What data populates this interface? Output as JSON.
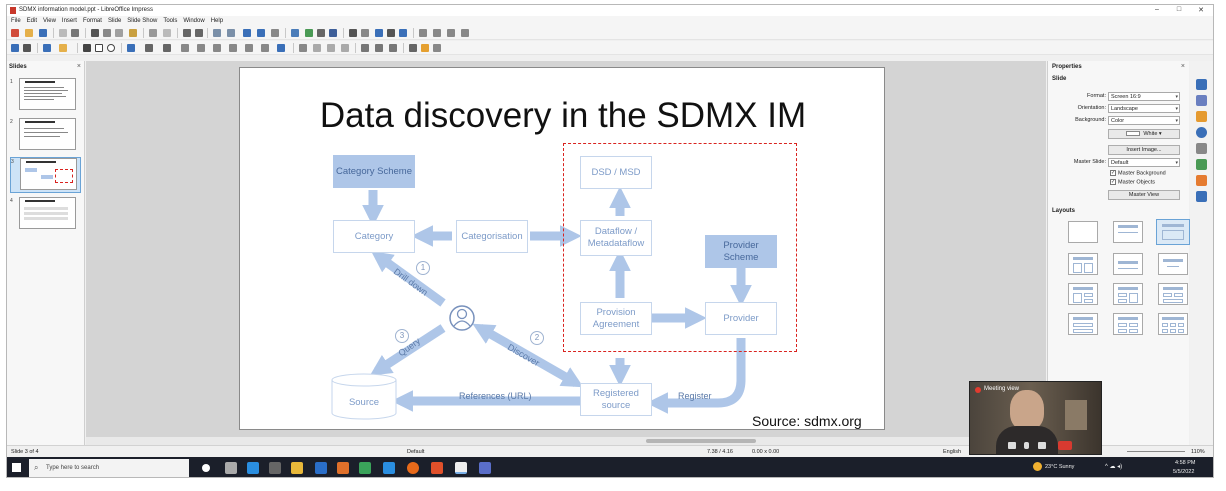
{
  "window": {
    "title": "SDMX information model.ppt - LibreOffice Impress",
    "controls": [
      "–",
      "□",
      "✕"
    ]
  },
  "menu": [
    "File",
    "Edit",
    "View",
    "Insert",
    "Format",
    "Slide",
    "Slide Show",
    "Tools",
    "Window",
    "Help"
  ],
  "slides_pane": {
    "title": "Slides",
    "close": "×",
    "numbers": [
      "1",
      "2",
      "3",
      "4"
    ],
    "selected_index": 3
  },
  "slide": {
    "title": "Data discovery in the SDMX IM",
    "boxes": {
      "category_scheme": "Category Scheme",
      "category": "Category",
      "categorisation": "Categorisation",
      "dsd_msd": "DSD / MSD",
      "dataflow": "Dataflow / Metadataflow",
      "provider_scheme": "Provider Scheme",
      "provision_agreement": "Provision Agreement",
      "provider": "Provider",
      "registered_source": "Registered source",
      "source": "Source"
    },
    "arrow_labels": {
      "drill_down": "Drill down",
      "query": "Query",
      "discover": "Discover",
      "references": "References (URL)",
      "register": "Register"
    },
    "step_numbers": [
      "1",
      "2",
      "3"
    ],
    "source_credit": "Source: sdmx.org"
  },
  "properties": {
    "title": "Properties",
    "close": "×",
    "slide_section": "Slide",
    "format_label": "Format:",
    "format_value": "Screen 16:9",
    "orientation_label": "Orientation:",
    "orientation_value": "Landscape",
    "background_label": "Background:",
    "background_value": "Color",
    "color_value": "White",
    "insert_image": "Insert Image...",
    "master_slide_label": "Master Slide:",
    "master_slide_value": "Default",
    "master_background": "Master Background",
    "master_objects": "Master Objects",
    "master_view": "Master View",
    "layouts_section": "Layouts"
  },
  "statusbar": {
    "slide_info": "Slide 3 of 4",
    "master": "Default",
    "position": "7.38 / 4.16",
    "size": "0.00 x 0.00",
    "language": "English",
    "zoom": "110%"
  },
  "taskbar": {
    "search_placeholder": "Type here to search",
    "weather": "23°C  Sunny",
    "time": "4:58 PM",
    "date": "5/5/2022"
  },
  "webcam": {
    "title": "Meeting view"
  },
  "colors": {
    "accent_fill": "#aec6e8",
    "box_text": "#7d9bc8",
    "red_highlight": "#d9231f",
    "arrow": "#aec6e8"
  }
}
